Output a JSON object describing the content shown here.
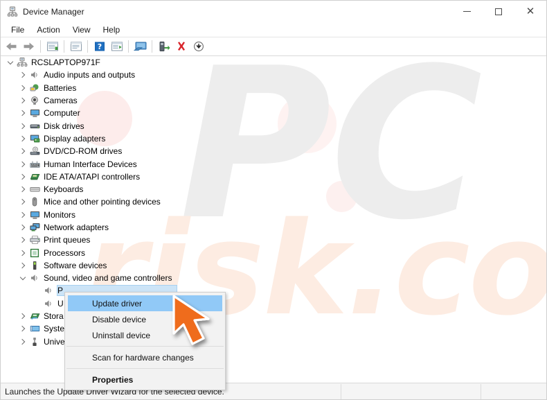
{
  "window": {
    "title": "Device Manager",
    "icon": "device-manager-icon",
    "buttons": {
      "minimize": "minimize-icon",
      "maximize": "maximize-icon",
      "close": "close-icon"
    }
  },
  "menubar": {
    "items": [
      "File",
      "Action",
      "View",
      "Help"
    ]
  },
  "toolbar": {
    "buttons": [
      {
        "name": "back-icon",
        "type": "back"
      },
      {
        "name": "forward-icon",
        "type": "forward"
      },
      {
        "sep": true
      },
      {
        "name": "properties-icon",
        "type": "properties"
      },
      {
        "sep": true
      },
      {
        "name": "show-hide-console-tree-icon",
        "type": "console"
      },
      {
        "sep": true
      },
      {
        "name": "help-icon",
        "type": "help"
      },
      {
        "name": "update-driver-icon",
        "type": "update"
      },
      {
        "sep": true
      },
      {
        "name": "scan-for-hardware-changes-icon",
        "type": "scan"
      },
      {
        "sep": true
      },
      {
        "name": "enable-device-icon",
        "type": "enable"
      },
      {
        "name": "uninstall-device-icon",
        "type": "uninstall"
      },
      {
        "name": "install-legacy-hardware-icon",
        "type": "download"
      }
    ]
  },
  "tree": {
    "root": {
      "label": "RCSLAPTOP971F",
      "icon": "computer-node-icon",
      "expanded": true
    },
    "nodes": [
      {
        "label": "Audio inputs and outputs",
        "icon": "speaker-icon",
        "expanded": false
      },
      {
        "label": "Batteries",
        "icon": "battery-icon",
        "expanded": false
      },
      {
        "label": "Cameras",
        "icon": "camera-icon",
        "expanded": false
      },
      {
        "label": "Computer",
        "icon": "monitor-icon",
        "expanded": false
      },
      {
        "label": "Disk drives",
        "icon": "disk-drive-icon",
        "expanded": false
      },
      {
        "label": "Display adapters",
        "icon": "display-adapter-icon",
        "expanded": false
      },
      {
        "label": "DVD/CD-ROM drives",
        "icon": "dvd-drive-icon",
        "expanded": false
      },
      {
        "label": "Human Interface Devices",
        "icon": "hid-icon",
        "expanded": false
      },
      {
        "label": "IDE ATA/ATAPI controllers",
        "icon": "ide-controller-icon",
        "expanded": false
      },
      {
        "label": "Keyboards",
        "icon": "keyboard-icon",
        "expanded": false
      },
      {
        "label": "Mice and other pointing devices",
        "icon": "mouse-icon",
        "expanded": false
      },
      {
        "label": "Monitors",
        "icon": "monitor-icon",
        "expanded": false
      },
      {
        "label": "Network adapters",
        "icon": "network-adapter-icon",
        "expanded": false
      },
      {
        "label": "Print queues",
        "icon": "printer-icon",
        "expanded": false
      },
      {
        "label": "Processors",
        "icon": "processor-icon",
        "expanded": false
      },
      {
        "label": "Software devices",
        "icon": "software-device-icon",
        "expanded": false
      },
      {
        "label": "Sound, video and game controllers",
        "icon": "speaker-icon",
        "expanded": true
      }
    ],
    "sound_children": [
      {
        "label": "P",
        "icon": "speaker-icon",
        "selected": true
      },
      {
        "label": "U",
        "icon": "speaker-icon",
        "selected": false
      }
    ],
    "tail_nodes": [
      {
        "label": "Stora",
        "icon": "storage-controller-icon",
        "expanded": false
      },
      {
        "label": "Syste",
        "icon": "system-device-icon",
        "expanded": false
      },
      {
        "label": "Unive",
        "icon": "usb-controller-icon",
        "expanded": false
      }
    ]
  },
  "context_menu": {
    "items": [
      {
        "label": "Update driver",
        "highlight": true,
        "bold": false
      },
      {
        "label": "Disable device",
        "highlight": false,
        "bold": false
      },
      {
        "label": "Uninstall device",
        "highlight": false,
        "bold": false
      },
      {
        "separator": true
      },
      {
        "label": "Scan for hardware changes",
        "highlight": false,
        "bold": false
      },
      {
        "separator": true
      },
      {
        "label": "Properties",
        "highlight": false,
        "bold": true
      }
    ]
  },
  "cursor": {
    "name": "orange-arrow-pointer",
    "color": "#ef6c1f"
  },
  "statusbar": {
    "text": "Launches the Update Driver Wizard for the selected device."
  },
  "watermark": {
    "primary": "PC",
    "secondary": "risk.com",
    "primary_color": "#ededed",
    "secondary_color": "#fdece2"
  },
  "colors": {
    "selection": "#cce4f7",
    "menu_highlight": "#91c9f7",
    "accent_orange": "#ef6c1f"
  }
}
